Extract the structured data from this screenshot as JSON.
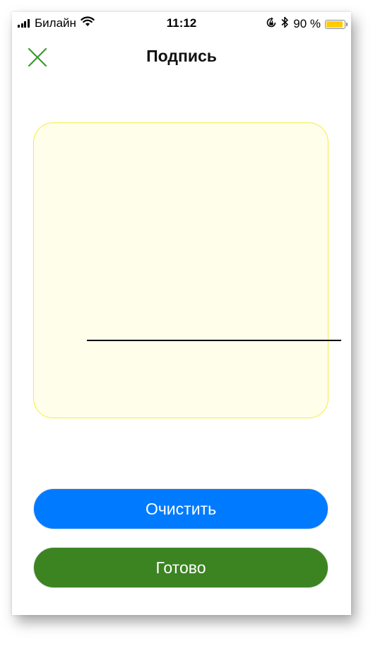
{
  "status_bar": {
    "carrier": "Билайн",
    "time": "11:12",
    "battery_text": "90 %",
    "battery_level": 0.9,
    "battery_color": "#ffcc00",
    "icons": [
      "signal-icon",
      "wifi-icon",
      "rotation-lock-icon",
      "bluetooth-icon",
      "battery-icon"
    ]
  },
  "header": {
    "title": "Подпись",
    "close_icon": "close-icon",
    "accent_color": "#3c9a2e"
  },
  "signature_pad": {
    "background_color": "#fffeea",
    "border_color": "#f5ee3a"
  },
  "actions": {
    "clear_label": "Очистить",
    "clear_color": "#007bff",
    "done_label": "Готово",
    "done_color": "#3c8422"
  }
}
